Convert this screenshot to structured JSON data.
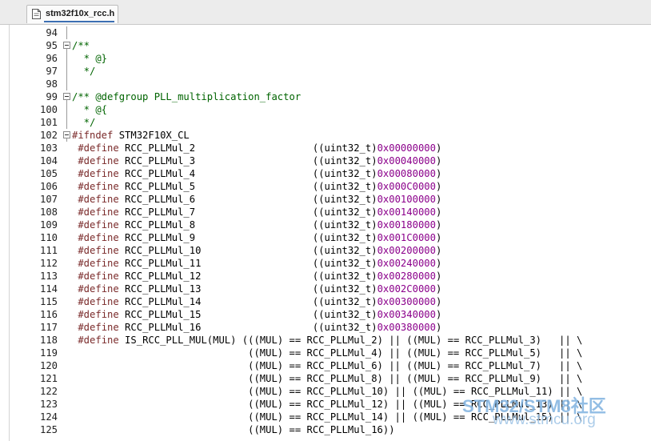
{
  "tab": {
    "label": "stm32f10x_rcc.h",
    "icon": "file-header-icon"
  },
  "colors": {
    "comment": "#006400",
    "keyword": "#7a2a2a",
    "number": "#8b008b",
    "tab_underline": "#3d6fb3"
  },
  "watermark": {
    "brand": "STM32/STM8社区",
    "url": "www.stmcu.org"
  },
  "lines": [
    {
      "n": "94",
      "fold": "line",
      "code": ""
    },
    {
      "n": "95",
      "fold": "minus",
      "code": "/**"
    },
    {
      "n": "96",
      "fold": "line",
      "code": "  * @}"
    },
    {
      "n": "97",
      "fold": "line",
      "code": "  */"
    },
    {
      "n": "98",
      "fold": "line",
      "code": ""
    },
    {
      "n": "99",
      "fold": "minus",
      "code": "/** @defgroup PLL_multiplication_factor"
    },
    {
      "n": "100",
      "fold": "line",
      "code": "  * @{"
    },
    {
      "n": "101",
      "fold": "line",
      "code": "  */"
    },
    {
      "n": "102",
      "fold": "minus",
      "code": "#ifndef STM32F10X_CL"
    },
    {
      "n": "103",
      "fold": "none",
      "code": " #define RCC_PLLMul_2                    ((uint32_t)0x00000000)"
    },
    {
      "n": "104",
      "fold": "none",
      "code": " #define RCC_PLLMul_3                    ((uint32_t)0x00040000)"
    },
    {
      "n": "105",
      "fold": "none",
      "code": " #define RCC_PLLMul_4                    ((uint32_t)0x00080000)"
    },
    {
      "n": "106",
      "fold": "none",
      "code": " #define RCC_PLLMul_5                    ((uint32_t)0x000C0000)"
    },
    {
      "n": "107",
      "fold": "none",
      "code": " #define RCC_PLLMul_6                    ((uint32_t)0x00100000)"
    },
    {
      "n": "108",
      "fold": "none",
      "code": " #define RCC_PLLMul_7                    ((uint32_t)0x00140000)"
    },
    {
      "n": "109",
      "fold": "none",
      "code": " #define RCC_PLLMul_8                    ((uint32_t)0x00180000)"
    },
    {
      "n": "110",
      "fold": "none",
      "code": " #define RCC_PLLMul_9                    ((uint32_t)0x001C0000)"
    },
    {
      "n": "111",
      "fold": "none",
      "code": " #define RCC_PLLMul_10                   ((uint32_t)0x00200000)"
    },
    {
      "n": "112",
      "fold": "none",
      "code": " #define RCC_PLLMul_11                   ((uint32_t)0x00240000)"
    },
    {
      "n": "113",
      "fold": "none",
      "code": " #define RCC_PLLMul_12                   ((uint32_t)0x00280000)"
    },
    {
      "n": "114",
      "fold": "none",
      "code": " #define RCC_PLLMul_13                   ((uint32_t)0x002C0000)"
    },
    {
      "n": "115",
      "fold": "none",
      "code": " #define RCC_PLLMul_14                   ((uint32_t)0x00300000)"
    },
    {
      "n": "116",
      "fold": "none",
      "code": " #define RCC_PLLMul_15                   ((uint32_t)0x00340000)"
    },
    {
      "n": "117",
      "fold": "none",
      "code": " #define RCC_PLLMul_16                   ((uint32_t)0x00380000)"
    },
    {
      "n": "118",
      "fold": "none",
      "code": " #define IS_RCC_PLL_MUL(MUL) (((MUL) == RCC_PLLMul_2) || ((MUL) == RCC_PLLMul_3)   || \\"
    },
    {
      "n": "119",
      "fold": "none",
      "code": "                              ((MUL) == RCC_PLLMul_4) || ((MUL) == RCC_PLLMul_5)   || \\"
    },
    {
      "n": "120",
      "fold": "none",
      "code": "                              ((MUL) == RCC_PLLMul_6) || ((MUL) == RCC_PLLMul_7)   || \\"
    },
    {
      "n": "121",
      "fold": "none",
      "code": "                              ((MUL) == RCC_PLLMul_8) || ((MUL) == RCC_PLLMul_9)   || \\"
    },
    {
      "n": "122",
      "fold": "none",
      "code": "                              ((MUL) == RCC_PLLMul_10) || ((MUL) == RCC_PLLMul_11) || \\"
    },
    {
      "n": "123",
      "fold": "none",
      "code": "                              ((MUL) == RCC_PLLMul_12) || ((MUL) == RCC_PLLMul_13) || \\"
    },
    {
      "n": "124",
      "fold": "none",
      "code": "                              ((MUL) == RCC_PLLMul_14) || ((MUL) == RCC_PLLMul_15) || \\"
    },
    {
      "n": "125",
      "fold": "none",
      "code": "                              ((MUL) == RCC_PLLMul_16))"
    }
  ]
}
